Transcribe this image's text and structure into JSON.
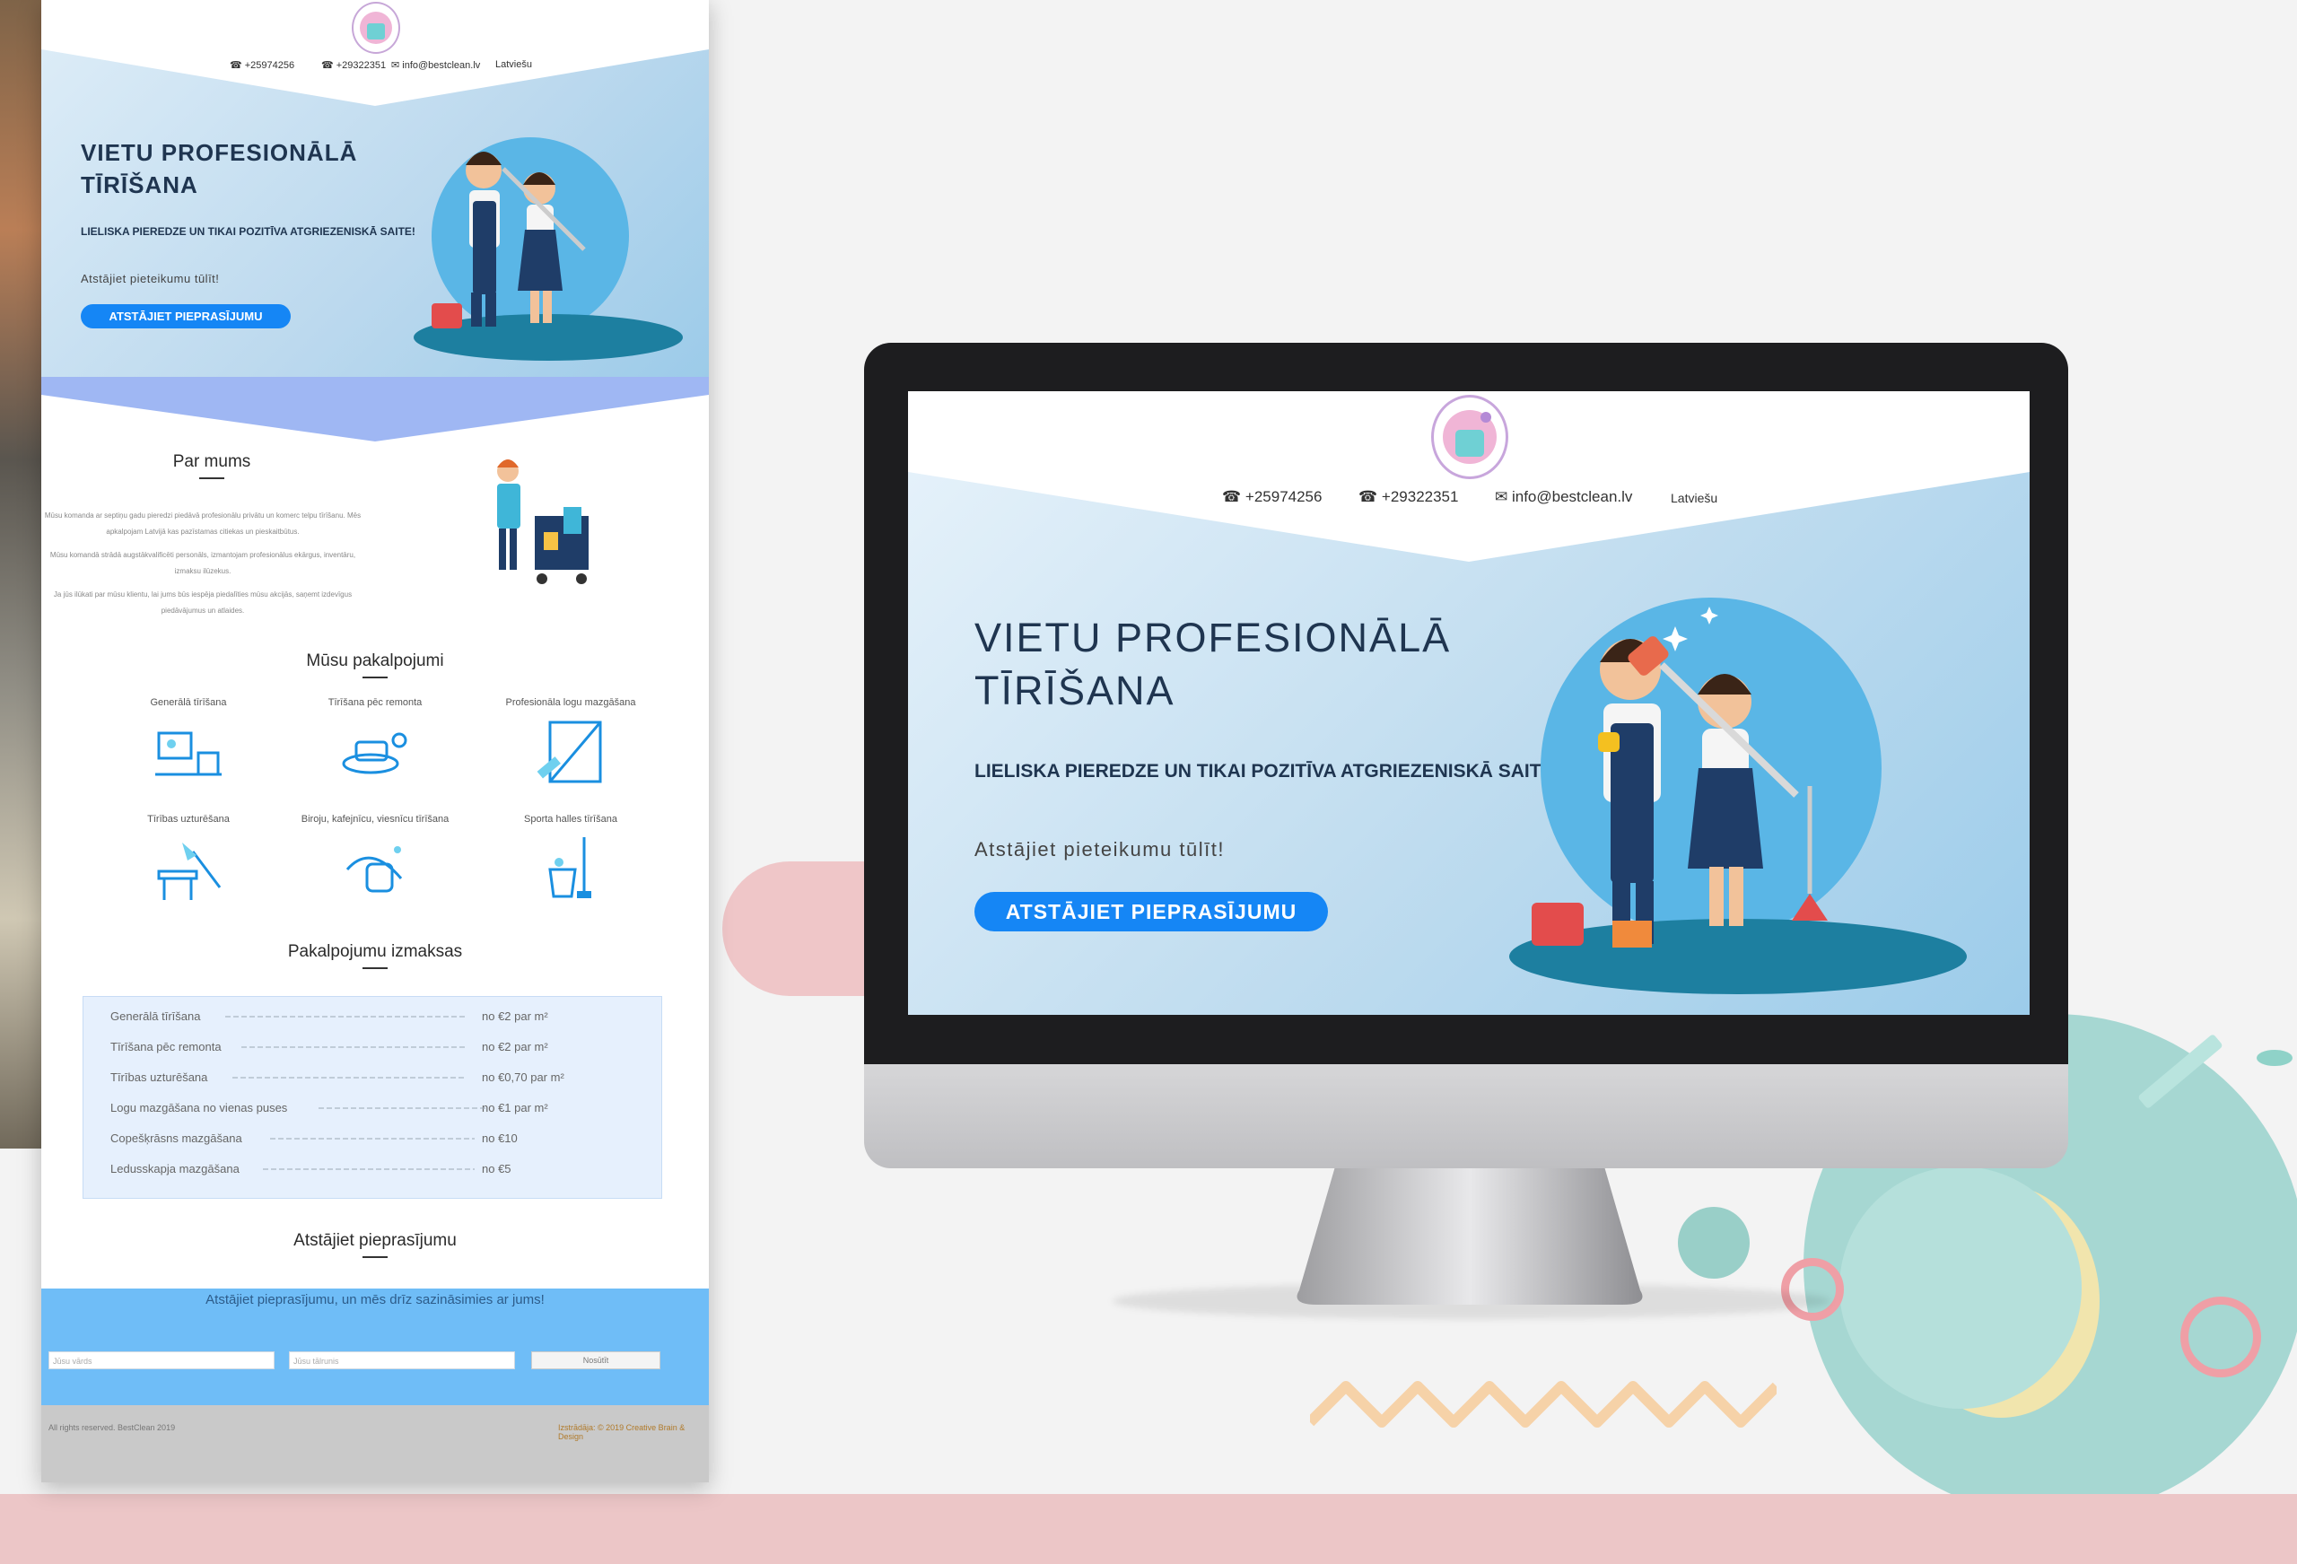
{
  "site": {
    "phone1": "☎ +25974256",
    "phone2": "☎ +29322351",
    "email": "✉ info@bestclean.lv",
    "language": "Latviešu"
  },
  "hero": {
    "title_line1": "VIETU PROFESIONĀLĀ",
    "title_line2": "TĪRĪŠANA",
    "subtitle": "LIELISKA PIEREDZE UN TIKAI POZITĪVA ATGRIEZENISKĀ SAITE!",
    "note": "Atstājiet pieteikumu tūlīt!",
    "button": "ATSTĀJIET PIEPRASĪJUMU"
  },
  "about": {
    "heading": "Par mums",
    "paragraphs": [
      "Mūsu komanda ar septiņu gadu pieredzi piedāvā profesionālu privātu un komerc telpu tīrīšanu. Mēs apkalpojam Latvijā kas pazīstamas citiekas un pieskaitbūtus.",
      "Mūsu komandā strādā augstākvalificēti personāls, izmantojam profesionālus ekārgus, inventāru, izmaksu ilūzekus.",
      "Ja jūs ilūkati par mūsu klientu, lai jums būs iespēja piedalīties mūsu akcijās, saņemt izdevīgus piedāvājumus un atlaides."
    ]
  },
  "services": {
    "heading": "Mūsu pakalpojumi",
    "items": [
      {
        "label": "Generālā tīrīšana",
        "icon": "house-cleaning-icon"
      },
      {
        "label": "Tīrīšana pēc remonta",
        "icon": "renovation-cleaning-icon"
      },
      {
        "label": "Profesionāla logu mazgāšana",
        "icon": "window-cleaning-icon"
      },
      {
        "label": "Tīrības uzturēšana",
        "icon": "dusting-icon"
      },
      {
        "label": "Biroju, kafejnīcu, viesnīcu tīrīšana",
        "icon": "office-cleaning-icon"
      },
      {
        "label": "Sporta halles tīrīšana",
        "icon": "mop-bucket-icon"
      }
    ]
  },
  "prices": {
    "heading": "Pakalpojumu izmaksas",
    "rows": [
      {
        "label": "Generālā tīrīšana",
        "value": "no €2 par m²"
      },
      {
        "label": "Tīrīšana pēc remonta",
        "value": "no €2 par m²"
      },
      {
        "label": "Tīrības uzturēšana",
        "value": "no €0,70 par m²"
      },
      {
        "label": "Logu mazgāšana no vienas puses",
        "value": "no €1 par m²"
      },
      {
        "label": "Copešķrāsns mazgāšana",
        "value": "no €10"
      },
      {
        "label": "Ledusskapja mazgāšana",
        "value": "no €5"
      }
    ]
  },
  "form": {
    "heading": "Atstājiet pieprasījumu",
    "message": "Atstājiet pieprasījumu, un mēs drīz sazināsimies ar jums!",
    "name_placeholder": "Jūsu vārds",
    "phone_placeholder": "Jūsu tālrunis",
    "submit": "Nosūtīt"
  },
  "footer": {
    "left": "All rights reserved. BestClean 2019",
    "right": "Izstrādāja: © 2019 Creative Brain & Design"
  },
  "colors": {
    "accent": "#1586f5",
    "hero_blue": "#9ccbe9",
    "form_band": "#6fbdf7"
  }
}
